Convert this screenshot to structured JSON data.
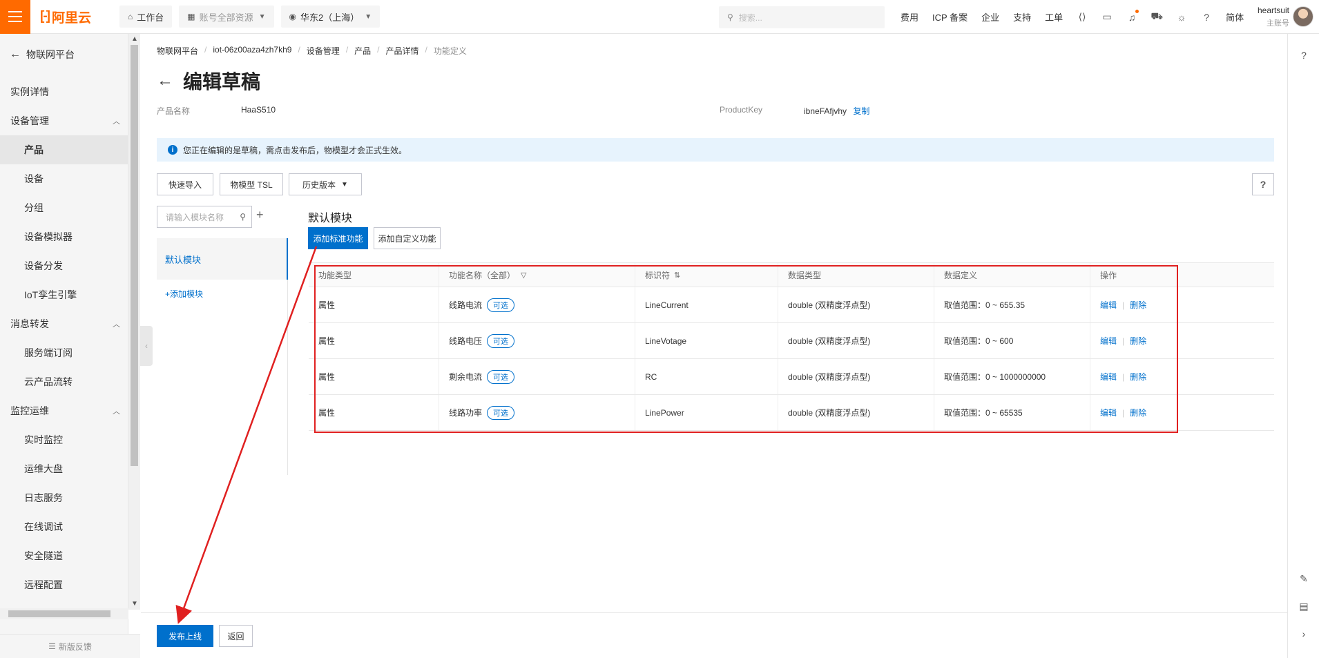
{
  "topbar": {
    "logo": "阿里云",
    "workbench": "工作台",
    "account_scope": "账号全部资源",
    "region": "华东2（上海）",
    "search_placeholder": "搜索...",
    "links": [
      "费用",
      "ICP 备案",
      "企业",
      "支持",
      "工单"
    ],
    "language": "简体",
    "user_name": "heartsuit",
    "user_role": "主账号"
  },
  "sidebar": {
    "back_label": "物联网平台",
    "items": [
      {
        "label": "实例详情",
        "level": 1
      },
      {
        "label": "设备管理",
        "level": 1,
        "expandable": true
      },
      {
        "label": "产品",
        "level": 2,
        "active": true
      },
      {
        "label": "设备",
        "level": 2
      },
      {
        "label": "分组",
        "level": 2
      },
      {
        "label": "设备模拟器",
        "level": 2
      },
      {
        "label": "设备分发",
        "level": 2
      },
      {
        "label": "IoT孪生引擎",
        "level": 2
      },
      {
        "label": "消息转发",
        "level": 1,
        "expandable": true
      },
      {
        "label": "服务端订阅",
        "level": 2
      },
      {
        "label": "云产品流转",
        "level": 2
      },
      {
        "label": "监控运维",
        "level": 1,
        "expandable": true
      },
      {
        "label": "实时监控",
        "level": 2
      },
      {
        "label": "运维大盘",
        "level": 2
      },
      {
        "label": "日志服务",
        "level": 2
      },
      {
        "label": "在线调试",
        "level": 2
      },
      {
        "label": "安全隧道",
        "level": 2
      },
      {
        "label": "远程配置",
        "level": 2
      }
    ],
    "feedback": "新版反馈"
  },
  "breadcrumb": [
    "物联网平台",
    "iot-06z00aza4zh7kh9",
    "设备管理",
    "产品",
    "产品详情",
    "功能定义"
  ],
  "page_title": "编辑草稿",
  "meta": {
    "product_name_label": "产品名称",
    "product_name": "HaaS510",
    "product_key_label": "ProductKey",
    "product_key": "ibneFAfjvhy",
    "copy_label": "复制"
  },
  "notice": "您正在编辑的是草稿，需点击发布后，物模型才会正式生效。",
  "toolbar": {
    "quick_import": "快速导入",
    "tsl": "物模型 TSL",
    "history": "历史版本",
    "help": "?"
  },
  "modules": {
    "search_placeholder": "请输入模块名称",
    "items": [
      "默认模块"
    ],
    "add_label": "+添加模块"
  },
  "module_title": "默认模块",
  "actions": {
    "add_standard": "添加标准功能",
    "add_custom": "添加自定义功能"
  },
  "table": {
    "headers": [
      "功能类型",
      "功能名称（全部）",
      "标识符",
      "数据类型",
      "数据定义",
      "操作"
    ],
    "rows": [
      {
        "type": "属性",
        "name": "线路电流",
        "tag": "可选",
        "identifier": "LineCurrent",
        "data_type": "double (双精度浮点型)",
        "definition": "取值范围：0 ~ 655.35",
        "edit": "编辑",
        "delete": "删除"
      },
      {
        "type": "属性",
        "name": "线路电压",
        "tag": "可选",
        "identifier": "LineVotage",
        "data_type": "double (双精度浮点型)",
        "definition": "取值范围：0 ~ 600",
        "edit": "编辑",
        "delete": "删除"
      },
      {
        "type": "属性",
        "name": "剩余电流",
        "tag": "可选",
        "identifier": "RC",
        "data_type": "double (双精度浮点型)",
        "definition": "取值范围：0 ~ 1000000000",
        "edit": "编辑",
        "delete": "删除"
      },
      {
        "type": "属性",
        "name": "线路功率",
        "tag": "可选",
        "identifier": "LinePower",
        "data_type": "double (双精度浮点型)",
        "definition": "取值范围：0 ~ 65535",
        "edit": "编辑",
        "delete": "删除"
      }
    ]
  },
  "footer": {
    "publish": "发布上线",
    "back": "返回"
  },
  "colors": {
    "brand": "#ff6a00",
    "primary": "#0070cc",
    "annotation": "#e02020",
    "notice_bg": "#e7f3fd"
  }
}
